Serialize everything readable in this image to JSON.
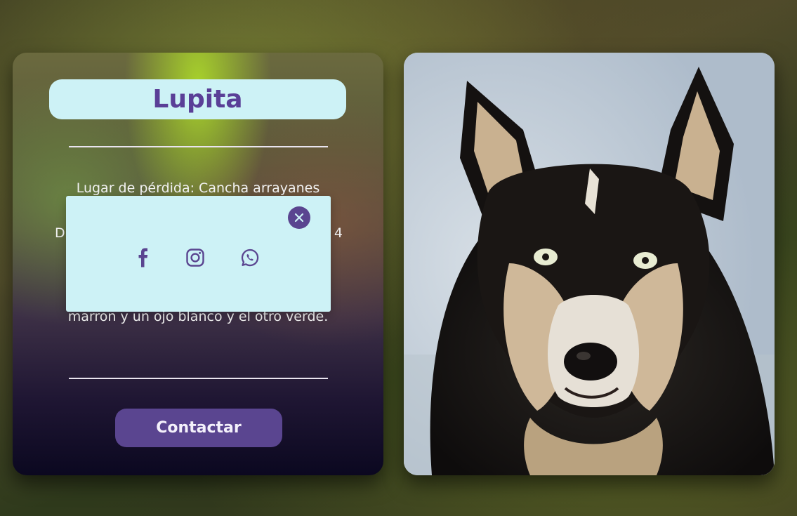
{
  "pet": {
    "name": "Lupita",
    "lost_place": "Lugar de pérdida: Cancha arrayanes",
    "date_line_start": "D",
    "date_line_end": "4",
    "description": "marron y un ojo blanco y el otro verde."
  },
  "actions": {
    "contact_label": "Contactar"
  },
  "share_popup": {
    "close_icon": "close-icon",
    "networks": [
      {
        "icon": "facebook-icon"
      },
      {
        "icon": "instagram-icon"
      },
      {
        "icon": "whatsapp-icon"
      }
    ]
  },
  "photo": {
    "subject": "dog-photo"
  },
  "colors": {
    "accent": "#5a4590",
    "pill": "#cdf2f6",
    "name_text": "#5a3f97",
    "text_light": "#f2f2f2"
  }
}
